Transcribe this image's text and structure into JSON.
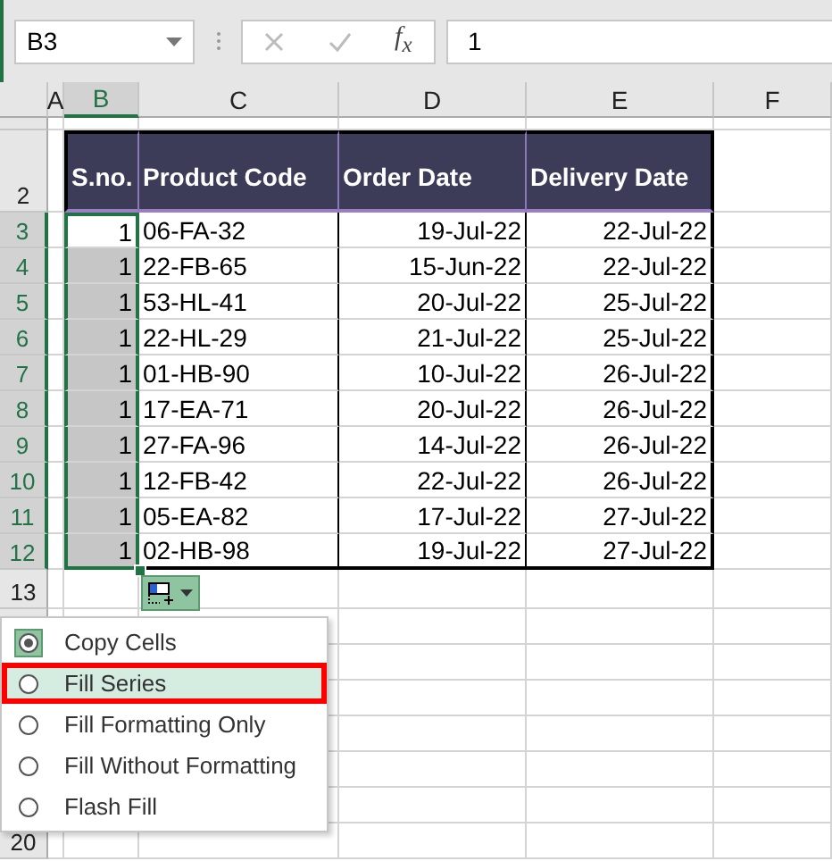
{
  "name_box": {
    "value": "B3"
  },
  "formula_bar": {
    "function_label": "f$_{x}$",
    "value": "1"
  },
  "columns": [
    {
      "label": "A",
      "selected": false
    },
    {
      "label": "B",
      "selected": true
    },
    {
      "label": "C",
      "selected": false
    },
    {
      "label": "D",
      "selected": false
    },
    {
      "label": "E",
      "selected": false
    },
    {
      "label": "F",
      "selected": false
    }
  ],
  "table": {
    "header_row": "2",
    "columns": [
      "S.no.",
      "Product Code",
      "Order Date",
      "Delivery Date"
    ],
    "rows": [
      {
        "row": "3",
        "selected": true,
        "active": true,
        "cells": [
          "1",
          "06-FA-32",
          "19-Jul-22",
          "22-Jul-22"
        ]
      },
      {
        "row": "4",
        "selected": true,
        "active": false,
        "cells": [
          "1",
          "22-FB-65",
          "15-Jun-22",
          "22-Jul-22"
        ]
      },
      {
        "row": "5",
        "selected": true,
        "active": false,
        "cells": [
          "1",
          "53-HL-41",
          "20-Jul-22",
          "25-Jul-22"
        ]
      },
      {
        "row": "6",
        "selected": true,
        "active": false,
        "cells": [
          "1",
          "22-HL-29",
          "21-Jul-22",
          "25-Jul-22"
        ]
      },
      {
        "row": "7",
        "selected": true,
        "active": false,
        "cells": [
          "1",
          "01-HB-90",
          "10-Jul-22",
          "26-Jul-22"
        ]
      },
      {
        "row": "8",
        "selected": true,
        "active": false,
        "cells": [
          "1",
          "17-EA-71",
          "20-Jul-22",
          "26-Jul-22"
        ]
      },
      {
        "row": "9",
        "selected": true,
        "active": false,
        "cells": [
          "1",
          "27-FA-96",
          "14-Jul-22",
          "26-Jul-22"
        ]
      },
      {
        "row": "10",
        "selected": true,
        "active": false,
        "cells": [
          "1",
          "12-FB-42",
          "22-Jul-22",
          "26-Jul-22"
        ]
      },
      {
        "row": "11",
        "selected": true,
        "active": false,
        "cells": [
          "1",
          "05-EA-82",
          "17-Jul-22",
          "27-Jul-22"
        ]
      },
      {
        "row": "12",
        "selected": true,
        "active": false,
        "cells": [
          "1",
          "02-HB-98",
          "19-Jul-22",
          "27-Jul-22"
        ]
      }
    ]
  },
  "empty_rows": [
    {
      "row": "13"
    },
    {
      "row": ""
    },
    {
      "row": ""
    },
    {
      "row": ""
    },
    {
      "row": ""
    },
    {
      "row": ""
    },
    {
      "row": ""
    },
    {
      "row": "20"
    }
  ],
  "autofill_menu": {
    "items": [
      {
        "label": "Copy Cells",
        "selected": true,
        "highlighted": false
      },
      {
        "label": "Fill Series",
        "selected": false,
        "highlighted": true
      },
      {
        "label": "Fill Formatting Only",
        "selected": false,
        "highlighted": false
      },
      {
        "label": "Fill Without Formatting",
        "selected": false,
        "highlighted": false
      },
      {
        "label": "Flash Fill",
        "selected": false,
        "highlighted": false
      }
    ]
  }
}
